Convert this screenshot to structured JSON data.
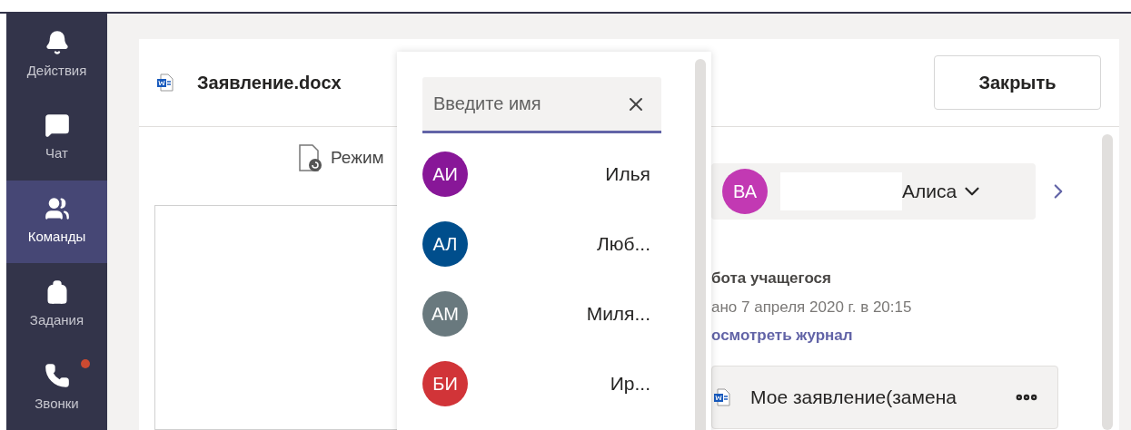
{
  "sidebar": {
    "items": [
      {
        "label": "Действия",
        "selected": false,
        "badge": false
      },
      {
        "label": "Чат",
        "selected": false,
        "badge": false
      },
      {
        "label": "Команды",
        "selected": true,
        "badge": false
      },
      {
        "label": "Задания",
        "selected": false,
        "badge": false
      },
      {
        "label": "Звонки",
        "selected": false,
        "badge": true
      }
    ]
  },
  "document": {
    "title": "Заявление.docx",
    "close_button": "Закрыть",
    "mode_label": "Режим"
  },
  "people_picker": {
    "search": {
      "placeholder": "Введите имя"
    },
    "people": [
      {
        "initials": "АИ",
        "name": "Илья",
        "color": "#881798"
      },
      {
        "initials": "АЛ",
        "name": "Люб...",
        "color": "#004e8c"
      },
      {
        "initials": "АМ",
        "name": "Миля...",
        "color": "#69797e"
      },
      {
        "initials": "БИ",
        "name": "Ир...",
        "color": "#d13438"
      }
    ]
  },
  "student_panel": {
    "student": {
      "initials": "ВА",
      "name": "Алиса",
      "color": "#c239b3"
    },
    "work_title": "бота учащегося",
    "submitted": "ано 7 апреля 2020 г. в 20:15",
    "history_link": "осмотреть журнал",
    "file_name": "Мое заявление(замена"
  }
}
